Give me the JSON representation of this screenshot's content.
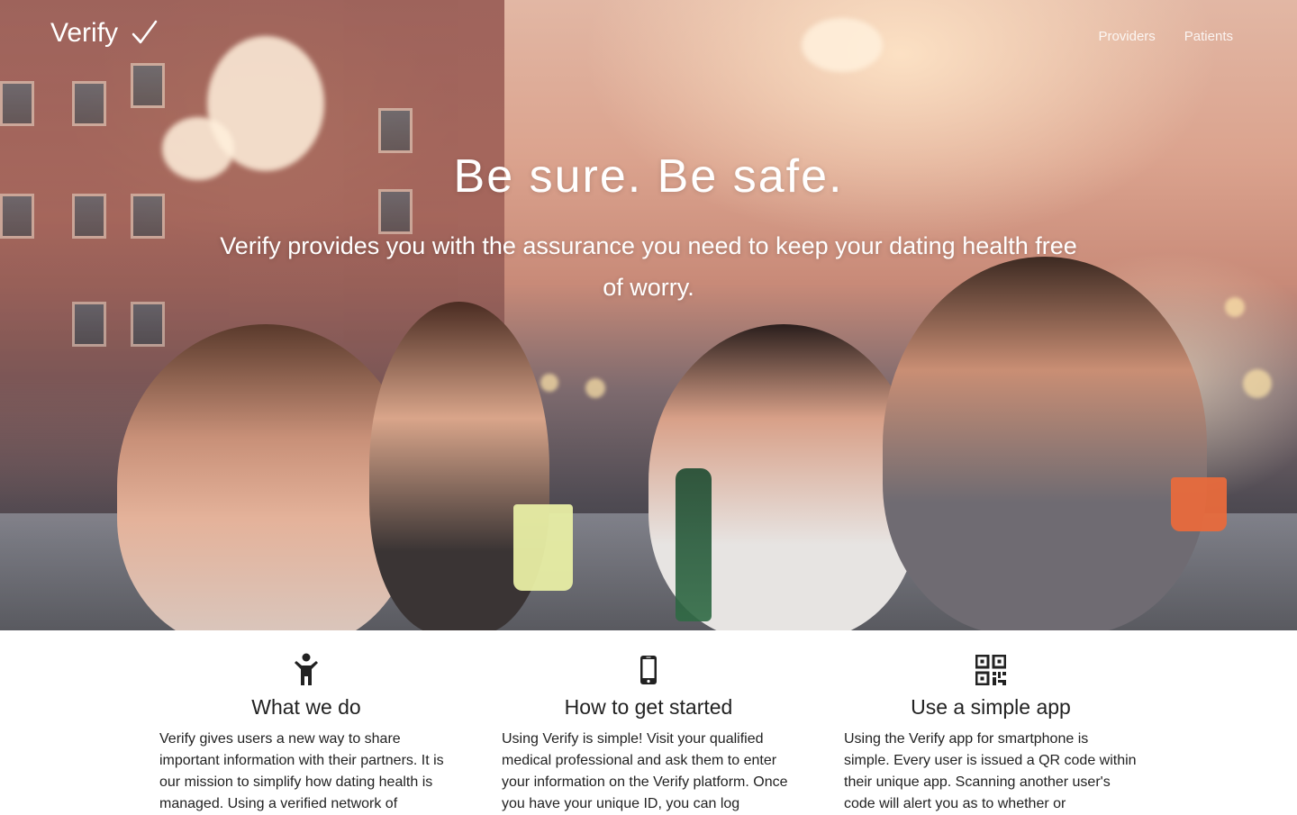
{
  "nav": {
    "brand": "Verify",
    "brand_icon": "checkmark-icon",
    "links": [
      "Providers",
      "Patients"
    ]
  },
  "hero": {
    "headline": "Be sure. Be safe.",
    "subheadline": "Verify provides you with the assurance you need to keep your dating health free of worry."
  },
  "features": [
    {
      "icon": "person-icon",
      "title": "What we do",
      "text": "Verify gives users a new way to share important information with their partners. It is our mission to simplify how dating health is managed. Using a verified network of"
    },
    {
      "icon": "mobile-phone-icon",
      "title": "How to get started",
      "text": "Using Verify is simple! Visit your qualified medical professional and ask them to enter your information on the Verify platform. Once you have your unique ID, you can log"
    },
    {
      "icon": "qr-code-icon",
      "title": "Use a simple app",
      "text": "Using the Verify app for smartphone is simple. Every user is issued a QR code within their unique app. Scanning another user's code will alert you as to whether or"
    }
  ]
}
